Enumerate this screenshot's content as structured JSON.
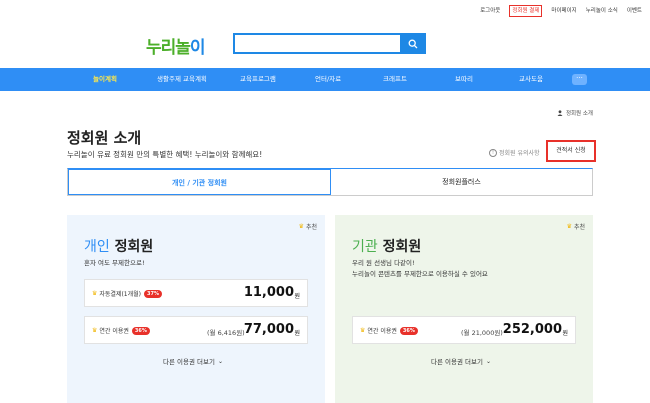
{
  "topbar": {
    "items": [
      "로그아웃",
      "정회원 결제",
      "마이페이지",
      "누리놀이 소식",
      "이벤트"
    ],
    "highlight_index": 1
  },
  "logo": {
    "text_a": "누리놀",
    "text_b": "이"
  },
  "search": {
    "value": "",
    "placeholder": ""
  },
  "gnb": {
    "items": [
      "놀이계획",
      "생활주제 교육계획",
      "교육프로그램",
      "언터/자료",
      "크래프트",
      "보따리",
      "교사도움"
    ],
    "active_index": 0,
    "more": "···"
  },
  "breadcrumb": "정회원 소개",
  "page": {
    "title": "정회원 소개",
    "subtitle": "누리놀이 유료 정회원 만의 특별한 혜택! 누리놀이와 함께해요!",
    "notice": "정회원 유의사항",
    "quote_button": "견적서 신청"
  },
  "tabs": [
    "개인 / 기관 정회원",
    "정회원플러스"
  ],
  "active_tab": 0,
  "cards": [
    {
      "recommend": "추천",
      "title_hl": "개인",
      "title_rest": " 정회원",
      "desc": [
        "혼자 여도 무제한으로!"
      ],
      "plans": [
        {
          "label": "자동결제(1개월)",
          "badge": "37%",
          "sub": "",
          "price": "11,000",
          "unit": "원"
        },
        {
          "label": "연간 이용권",
          "badge": "36%",
          "sub": "(월 6,416원)",
          "price": "77,000",
          "unit": "원"
        }
      ],
      "more": "다른 이용권 더보기"
    },
    {
      "recommend": "추천",
      "title_hl": "기관",
      "title_rest": " 정회원",
      "desc": [
        "우리 원 선생님 다같이!",
        "누리놀이 콘텐츠를 무제한으로 이용하실 수 있어요"
      ],
      "plans": [
        {
          "label": "연간 이용권",
          "badge": "36%",
          "sub": "(월 21,000원)",
          "price": "252,000",
          "unit": "원"
        }
      ],
      "more": "다른 이용권 더보기"
    }
  ],
  "colors": {
    "primary": "#2f8ef5",
    "accent_red": "#e8312a",
    "active_nav": "#ffe94a",
    "card_blue": "#eef5fd",
    "card_green": "#eef5ea"
  }
}
